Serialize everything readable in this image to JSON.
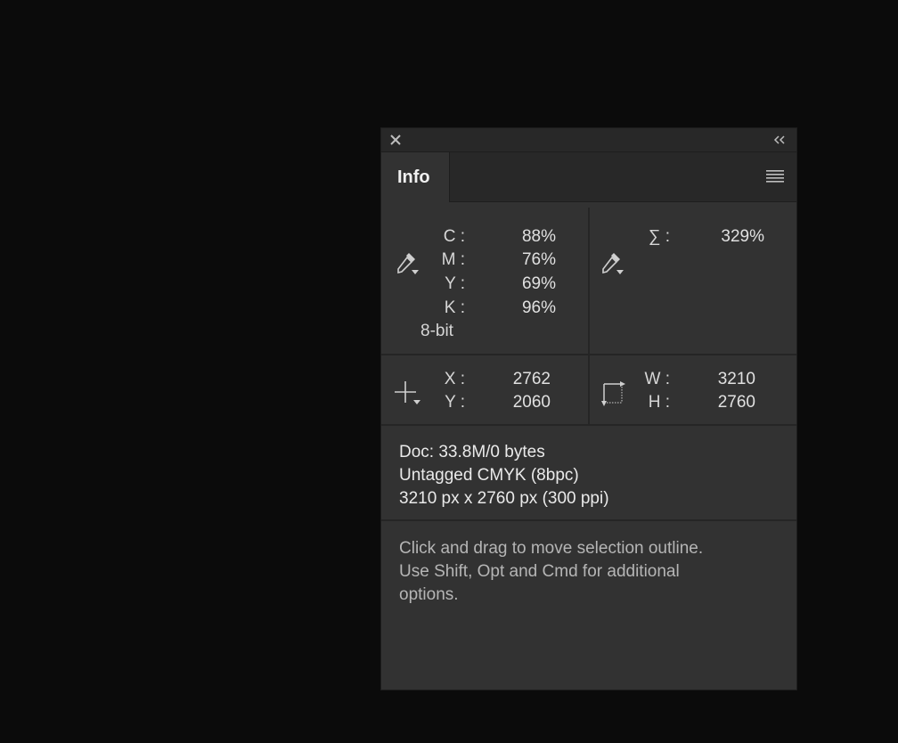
{
  "panel": {
    "tab_label": "Info",
    "icons": {
      "close": "close-icon",
      "collapse": "double-chevron-left-icon",
      "menu": "panel-menu-icon",
      "eyedropper": "eyedropper-icon",
      "crosshair": "crosshair-icon",
      "selection_size": "selection-size-icon"
    }
  },
  "color_readout_1": {
    "rows": [
      {
        "label": "C :",
        "value": "88%"
      },
      {
        "label": "M :",
        "value": "76%"
      },
      {
        "label": "Y :",
        "value": "69%"
      },
      {
        "label": "K :",
        "value": "96%"
      }
    ],
    "bit_depth": "8-bit"
  },
  "color_readout_2": {
    "label": "∑ :",
    "value": "329%"
  },
  "position": {
    "x_label": "X :",
    "x_value": "2762",
    "y_label": "Y :",
    "y_value": "2060"
  },
  "size": {
    "w_label": "W :",
    "w_value": "3210",
    "h_label": "H :",
    "h_value": "2760"
  },
  "document": {
    "lines": [
      "Doc: 33.8M/0 bytes",
      "Untagged CMYK (8bpc)",
      "3210 px x 2760 px (300 ppi)"
    ]
  },
  "hint": {
    "lines": [
      "Click and drag to move selection outline.",
      "Use Shift, Opt and Cmd for additional",
      "options."
    ]
  },
  "colors": {
    "background": "#0b0b0b",
    "panel": "#323232",
    "titlebar": "#282828",
    "text": "#e6e6e6",
    "hint_text": "#b5b5b5"
  }
}
